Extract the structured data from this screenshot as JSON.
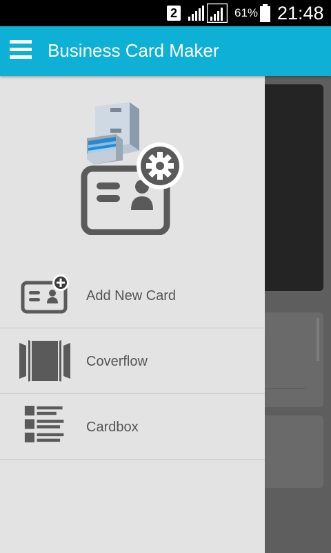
{
  "status_bar": {
    "sim_slot": "2",
    "battery_percent": "61%",
    "time": "21:48"
  },
  "toolbar": {
    "title": "Business Card Maker",
    "menu_icon": "hamburger-menu-icon"
  },
  "drawer": {
    "header_icon": "business-card-settings-logo",
    "items": [
      {
        "label": "Add New Card",
        "icon": "add-card-icon"
      },
      {
        "label": "Coverflow",
        "icon": "coverflow-icon"
      },
      {
        "label": "Cardbox",
        "icon": "cardbox-icon"
      }
    ]
  },
  "colors": {
    "toolbar": "#0fb0d6",
    "drawer_bg": "#e3e3e3",
    "icon_gray": "#5a5a5a",
    "text_gray": "#555555"
  }
}
